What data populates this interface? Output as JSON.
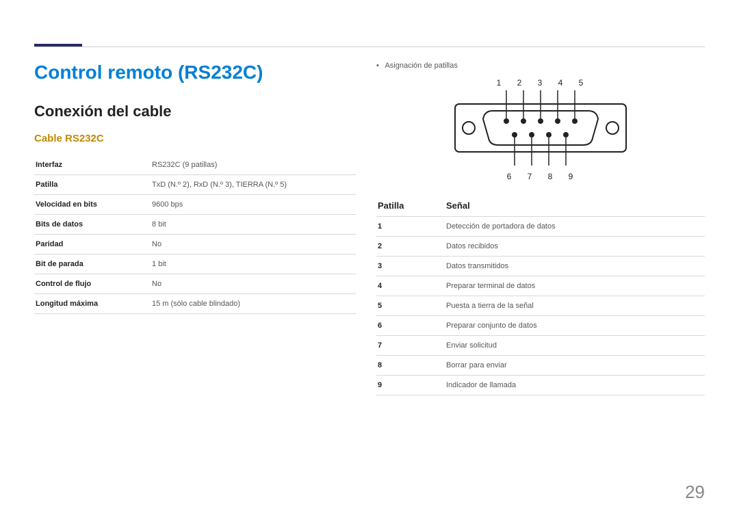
{
  "page_number": "29",
  "title": "Control remoto (RS232C)",
  "subtitle": "Conexión del cable",
  "section": "Cable RS232C",
  "spec_rows": [
    {
      "k": "Interfaz",
      "v": "RS232C (9 patillas)"
    },
    {
      "k": "Patilla",
      "v": "TxD (N.º 2), RxD (N.º 3), TIERRA (N.º 5)"
    },
    {
      "k": "Velocidad en bits",
      "v": "9600 bps"
    },
    {
      "k": "Bits de datos",
      "v": "8 bit"
    },
    {
      "k": "Paridad",
      "v": "No"
    },
    {
      "k": "Bit de parada",
      "v": "1 bit"
    },
    {
      "k": "Control de flujo",
      "v": "No"
    },
    {
      "k": "Longitud máxima",
      "v": "15 m (sólo cable blindado)"
    }
  ],
  "right_bullet": "Asignación de patillas",
  "pin_top_labels": "1 2 3 4 5",
  "pin_bottom_labels": "6 7 8 9",
  "pin_table": {
    "headers": {
      "pin": "Patilla",
      "signal": "Señal"
    },
    "rows": [
      {
        "pin": "1",
        "signal": "Detección de portadora de datos"
      },
      {
        "pin": "2",
        "signal": "Datos recibidos"
      },
      {
        "pin": "3",
        "signal": "Datos transmitidos"
      },
      {
        "pin": "4",
        "signal": "Preparar terminal de datos"
      },
      {
        "pin": "5",
        "signal": "Puesta a tierra de la señal"
      },
      {
        "pin": "6",
        "signal": "Preparar conjunto de datos"
      },
      {
        "pin": "7",
        "signal": "Enviar solicitud"
      },
      {
        "pin": "8",
        "signal": "Borrar para enviar"
      },
      {
        "pin": "9",
        "signal": "Indicador de llamada"
      }
    ]
  }
}
